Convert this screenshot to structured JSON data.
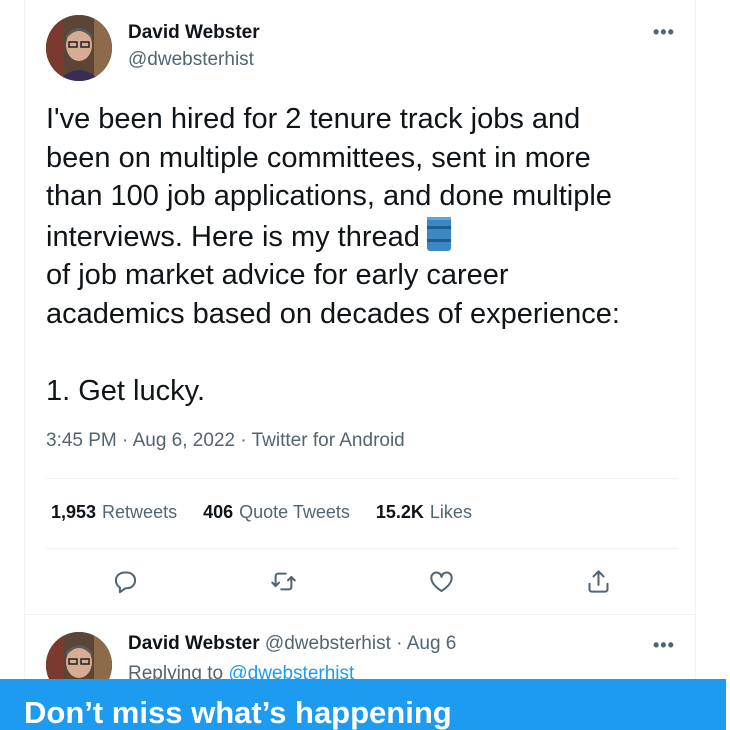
{
  "tweet": {
    "author_name": "David Webster",
    "author_handle": "@dwebsterhist",
    "text_before_emoji": "I've been hired for 2 tenure track jobs and\nbeen on multiple committees, sent in more\nthan 100 job applications, and done multiple\ninterviews. Here is my thread",
    "emoji": "oil-drum-emoji",
    "text_after_emoji": "\nof job market advice for early career\nacademics based on decades of experience:\n\n1. Get lucky.",
    "timestamp": "3:45 PM · Aug 6, 2022",
    "meta_sep": " · ",
    "source": "Twitter for Android",
    "more_label": "•••"
  },
  "stats": [
    {
      "count": "1,953",
      "label": "Retweets"
    },
    {
      "count": "406",
      "label": "Quote Tweets"
    },
    {
      "count": "15.2K",
      "label": "Likes"
    }
  ],
  "actions": [
    "reply-icon",
    "retweet-icon",
    "like-icon",
    "share-icon"
  ],
  "reply": {
    "author_name": "David Webster",
    "author_handle": "@dwebsterhist",
    "date": "· Aug 6",
    "replying_prefix": "Replying to ",
    "replying_to": "@dwebsterhist",
    "more_label": "•••"
  },
  "banner": {
    "title": "Don’t miss what’s happening"
  },
  "colors": {
    "accent": "#1d9bf0",
    "text_primary": "#0f1419",
    "text_secondary": "#536471"
  }
}
